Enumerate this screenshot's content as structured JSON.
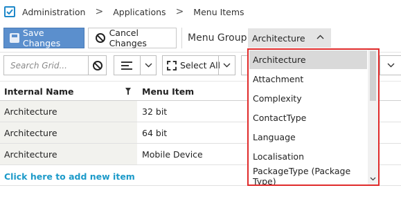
{
  "breadcrumb": {
    "items": [
      "Administration",
      "Applications",
      "Menu Items"
    ],
    "separator": ">"
  },
  "toolbar": {
    "save_label": "Save Changes",
    "cancel_label": "Cancel Changes",
    "menu_group_label": "Menu Group:",
    "menu_group_value": "Architecture",
    "search_placeholder": "Search Grid...",
    "select_all_label": "Select All"
  },
  "grid": {
    "columns": [
      "Internal Name",
      "Menu Item"
    ],
    "rows": [
      {
        "internal_name": "Architecture",
        "menu_item": "32 bit"
      },
      {
        "internal_name": "Architecture",
        "menu_item": "64 bit"
      },
      {
        "internal_name": "Architecture",
        "menu_item": "Mobile Device"
      }
    ],
    "add_link": "Click here to add new item"
  },
  "dropdown": {
    "options": [
      "Architecture",
      "Attachment",
      "Complexity",
      "ContactType",
      "Language",
      "Localisation",
      "PackageType (Package Type)"
    ],
    "selected": "Architecture"
  },
  "colors": {
    "accent": "#5b8fcd",
    "link": "#1c9ac9",
    "highlight_border": "#e02a2a"
  }
}
